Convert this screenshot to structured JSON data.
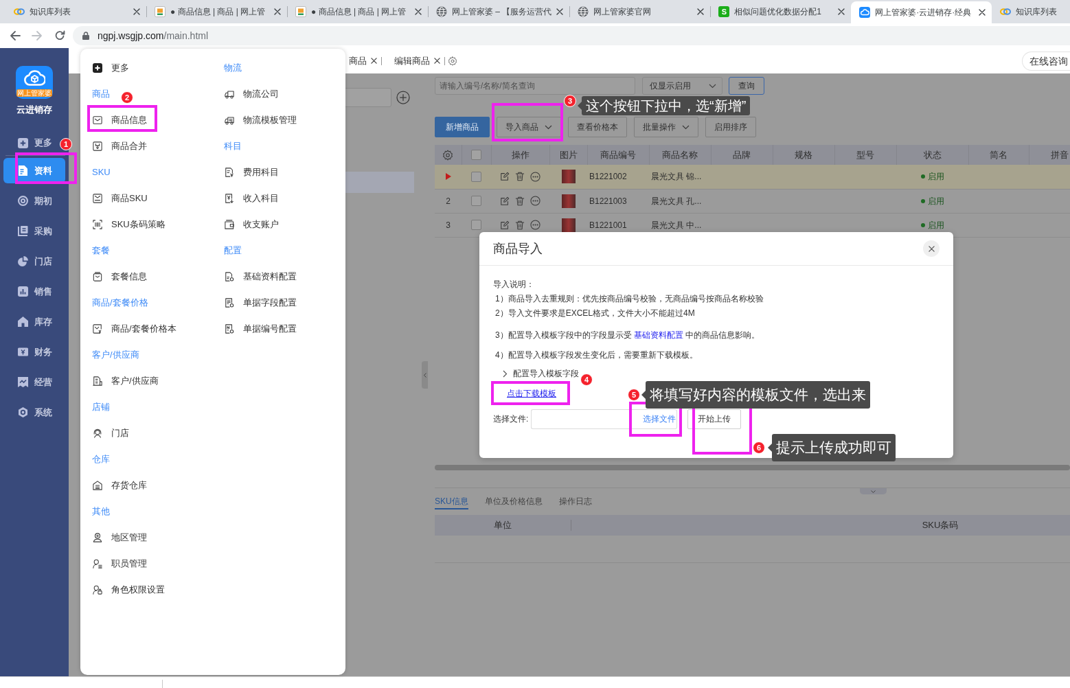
{
  "browser": {
    "tabs": [
      {
        "title": "知识库列表",
        "selected": false
      },
      {
        "title": "● 商品信息 | 商品 | 网上管",
        "selected": false
      },
      {
        "title": "● 商品信息 | 商品 | 网上管",
        "selected": false
      },
      {
        "title": "网上管家婆 – 【服务运营代",
        "selected": false
      },
      {
        "title": "网上管家婆官网",
        "selected": false
      },
      {
        "title": "相似问题优化数据分配1",
        "selected": false,
        "icon_letter": "S"
      },
      {
        "title": "网上管家婆·云进销存·经典",
        "selected": true
      },
      {
        "title": "知识库列表",
        "selected": false
      }
    ],
    "url_host": "ngpj.wsgjp.com",
    "url_path": "/main.html"
  },
  "sidebar": {
    "logo_ribbon": "网上管家婆",
    "app_name": "云进销存",
    "more": "更多",
    "items": [
      {
        "label": "资料",
        "selected": true
      },
      {
        "label": "期初",
        "selected": false
      },
      {
        "label": "采购",
        "selected": false
      },
      {
        "label": "门店",
        "selected": false
      },
      {
        "label": "销售",
        "selected": false
      },
      {
        "label": "库存",
        "selected": false
      },
      {
        "label": "财务",
        "selected": false
      },
      {
        "label": "经营",
        "selected": false
      },
      {
        "label": "系统",
        "selected": false
      }
    ]
  },
  "app_tabs": [
    {
      "label": "商品"
    },
    {
      "label": "编辑商品"
    }
  ],
  "online_help": "在线咨询",
  "menu": {
    "columns": [
      {
        "command": "更多",
        "groups": [
          {
            "title": "商品",
            "items": [
              "商品信息",
              "商品合并"
            ]
          },
          {
            "title": "SKU",
            "items": [
              "商品SKU",
              "SKU条码策略"
            ]
          },
          {
            "title": "套餐",
            "items": [
              "套餐信息"
            ]
          },
          {
            "title": "商品/套餐价格",
            "items": [
              "商品/套餐价格本"
            ]
          },
          {
            "title": "客户/供应商",
            "items": [
              "客户/供应商"
            ]
          },
          {
            "title": "店铺",
            "items": [
              "门店"
            ]
          },
          {
            "title": "仓库",
            "items": [
              "存货仓库"
            ]
          },
          {
            "title": "其他",
            "items": [
              "地区管理",
              "职员管理",
              "角色权限设置"
            ]
          }
        ]
      },
      {
        "groups": [
          {
            "title": "物流",
            "items": [
              "物流公司",
              "物流模板管理"
            ]
          },
          {
            "title": "科目",
            "items": [
              "费用科目",
              "收入科目",
              "收支账户"
            ]
          },
          {
            "title": "配置",
            "items": [
              "基础资料配置",
              "单据字段配置",
              "单据编号配置"
            ]
          }
        ]
      }
    ]
  },
  "product_list": {
    "search_placeholder": "请输入编号/名称/简名查询",
    "filter": "仅显示启用",
    "query_button": "查询",
    "toolbar": [
      {
        "label": "新增商品",
        "kind": "primary"
      },
      {
        "label": "导入商品",
        "kind": "dropdown"
      },
      {
        "label": "查看价格本",
        "kind": "plain"
      },
      {
        "label": "批量操作",
        "kind": "dropdown"
      },
      {
        "label": "启用排序",
        "kind": "plain"
      }
    ],
    "header_checked": false,
    "columns": [
      "操作",
      "图片",
      "商品编号",
      "商品名称",
      "品牌",
      "规格",
      "型号",
      "状态",
      "简名",
      "拼音"
    ],
    "rows": [
      {
        "current": true,
        "checked": false,
        "code": "B1221002",
        "name": "晨光文具 锦...",
        "status": "启用"
      },
      {
        "current": false,
        "index": "2",
        "checked": false,
        "code": "B1221003",
        "name": "晨光文具 孔...",
        "status": "启用"
      },
      {
        "current": false,
        "index": "3",
        "checked": false,
        "code": "B1221001",
        "name": "晨光文具 中...",
        "status": "启用"
      }
    ]
  },
  "detail": {
    "tabs": [
      {
        "label": "SKU信息",
        "selected": true
      },
      {
        "label": "单位及价格信息",
        "selected": false
      },
      {
        "label": "操作日志",
        "selected": false
      }
    ],
    "columns": [
      "单位",
      "SKU条码"
    ]
  },
  "dialog": {
    "title": "商品导入",
    "intro": "导入说明：",
    "rules": [
      "1）商品导入去重规则：优先按商品编号校验，无商品编号按商品名称校验",
      "2）导入文件要求是EXCEL格式，文件大小不能超过4M"
    ],
    "tips": [
      {
        "before": "3）配置导入模板字段中的字段显示受 ",
        "link": "基础资料配置",
        "after": " 中的商品信息影响。"
      },
      {
        "before": "4）配置导入模板字段发生变化后，需要重新下载模板。"
      }
    ],
    "expander": {
      "label": "配置导入模板字段",
      "expanded": false
    },
    "download_link": "点击下载模板",
    "file_label": "选择文件:",
    "file_button": "选择文件",
    "upload_button": "开始上传"
  },
  "annotations": [
    {
      "number": "1"
    },
    {
      "number": "2"
    },
    {
      "number": "3",
      "note": "这个按钮下拉中，选“新增”"
    },
    {
      "number": "4"
    },
    {
      "number": "5",
      "note": "将填写好内容的模板文件，选出来"
    },
    {
      "number": "6",
      "note": "提示上传成功即可"
    }
  ]
}
